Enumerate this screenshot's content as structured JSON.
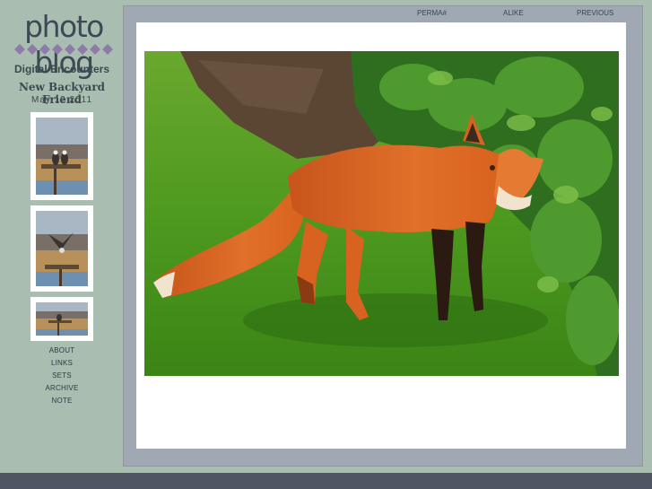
{
  "logo": {
    "text": "photo blog"
  },
  "site": {
    "title": "Digital Encounters"
  },
  "post": {
    "title": "New Backyard Friend",
    "date": "May 12 2011"
  },
  "thumbnails": [
    {
      "subject": "two ospreys perched on nest platform"
    },
    {
      "subject": "osprey landing on nest platform"
    },
    {
      "subject": "osprey on nest platform, wide view"
    }
  ],
  "nav": {
    "about": "ABOUT",
    "links": "LINKS",
    "sets": "SETS",
    "archive": "ARCHIVE",
    "note": "NOTE"
  },
  "topnav": {
    "perma": "PERMA#",
    "alike": "ALIKE",
    "previous": "PREVIOUS"
  },
  "photo": {
    "subject": "red fox standing on green grass beside a shrub"
  },
  "colors": {
    "background": "#a9bdb1",
    "frame": "#a0a8b3",
    "accent": "#8d7ca8",
    "text": "#3b4a4e"
  }
}
